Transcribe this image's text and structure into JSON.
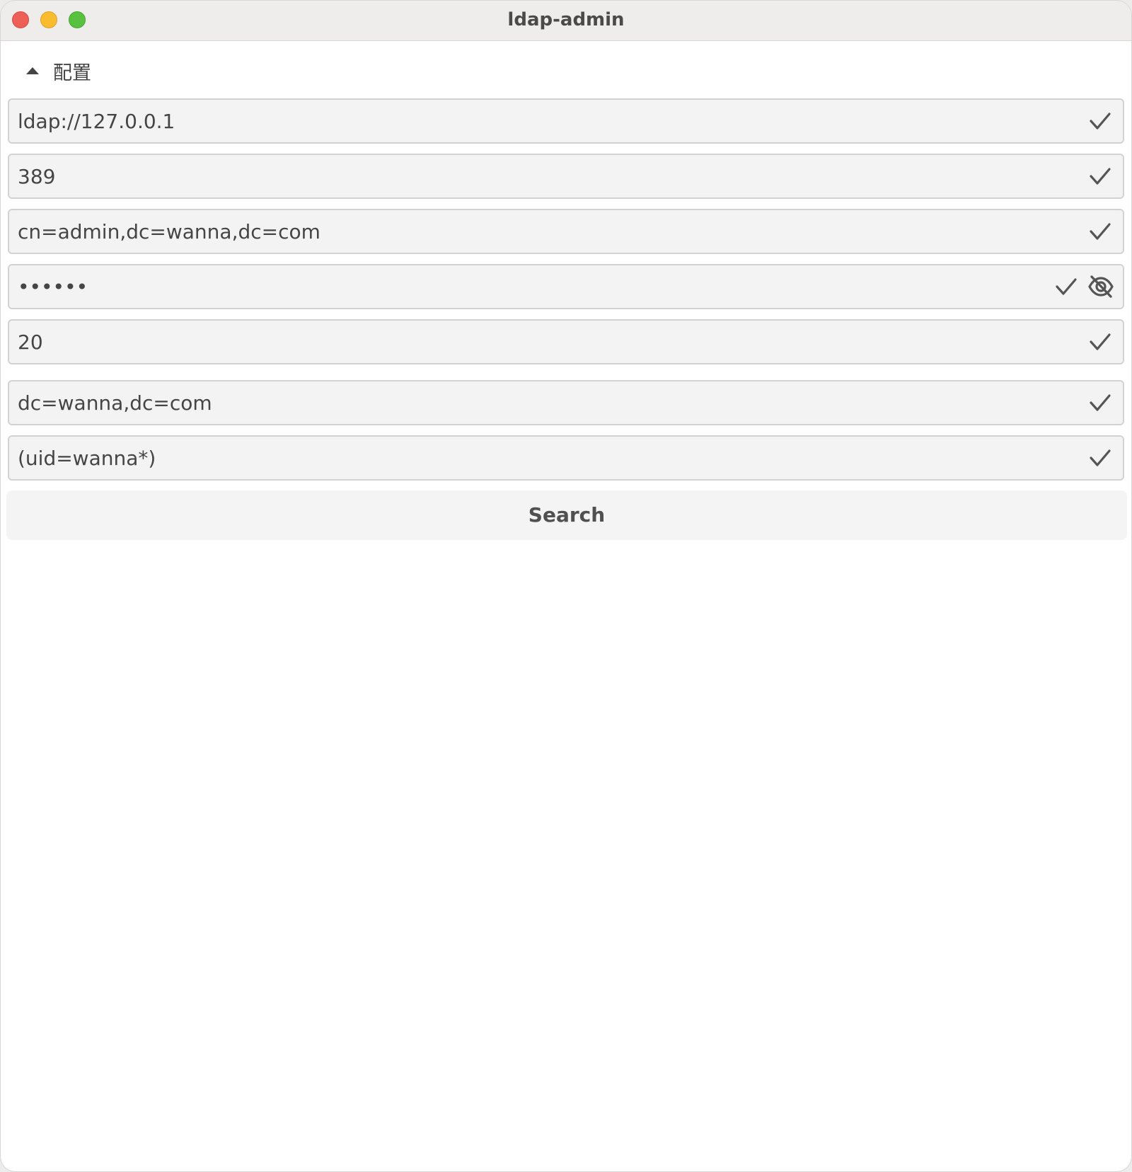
{
  "window": {
    "title": "ldap-admin"
  },
  "config": {
    "section_label": "配置",
    "fields": [
      {
        "value": "ldap://127.0.0.1"
      },
      {
        "value": "389"
      },
      {
        "value": "cn=admin,dc=wanna,dc=com"
      },
      {
        "value": "••••••"
      },
      {
        "value": "20"
      },
      {
        "value": "dc=wanna,dc=com"
      },
      {
        "value": "(uid=wanna*)"
      }
    ]
  },
  "actions": {
    "search_label": "Search"
  },
  "icons": {
    "valid": "check-icon",
    "password_toggle": "eye-off-icon",
    "collapse": "caret-up-icon"
  },
  "colors": {
    "close": "#ee5f58",
    "minimize": "#f9bc2f",
    "maximize": "#58c240"
  }
}
